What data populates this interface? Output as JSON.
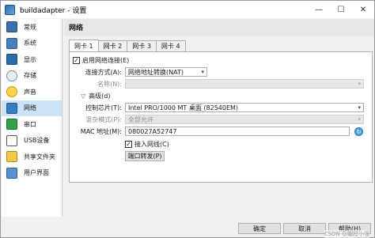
{
  "window": {
    "title": "buildadapter - 设置"
  },
  "window_controls": {
    "minimize": "—",
    "maximize": "☐",
    "close": "✕"
  },
  "sidebar": {
    "items": [
      {
        "label": "常规",
        "icon": "general-icon"
      },
      {
        "label": "系统",
        "icon": "system-icon"
      },
      {
        "label": "显示",
        "icon": "display-icon"
      },
      {
        "label": "存储",
        "icon": "storage-icon"
      },
      {
        "label": "声音",
        "icon": "audio-icon"
      },
      {
        "label": "网络",
        "icon": "network-icon"
      },
      {
        "label": "串口",
        "icon": "serial-port-icon"
      },
      {
        "label": "USB设备",
        "icon": "usb-icon"
      },
      {
        "label": "共享文件夹",
        "icon": "shared-folder-icon"
      },
      {
        "label": "用户界面",
        "icon": "user-interface-icon"
      }
    ],
    "active_index": 5
  },
  "section": {
    "title": "网络"
  },
  "tabs": [
    "网卡 1",
    "网卡 2",
    "网卡 3",
    "网卡 4"
  ],
  "adapter": {
    "enable_label": "启用网络连接(E)",
    "enable_checked": "✓",
    "attached_label": "连接方式(A):",
    "attached_value": "网络地址转换(NAT)",
    "name_label": "名称(N):",
    "name_value": "",
    "advanced_toggle": "▽",
    "advanced_label": "高级(d)",
    "chip_label": "控制芯片(T):",
    "chip_value": "Intel PRO/1000 MT 桌面 (82540EM)",
    "promisc_label": "混杂模式(P):",
    "promisc_value": "全部允许",
    "mac_label": "MAC 地址(M):",
    "mac_value": "080027A52747",
    "cable_label": "接入网线(C)",
    "cable_checked": "✓",
    "port_forward_label": "端口转发(P)",
    "refresh_icon": "↻",
    "dropdown_arrow": "▾"
  },
  "footer": {
    "ok_label": "确定",
    "cancel_label": "取消",
    "help_label": "帮助(H)",
    "watermark": "CSDN @编程小强"
  }
}
